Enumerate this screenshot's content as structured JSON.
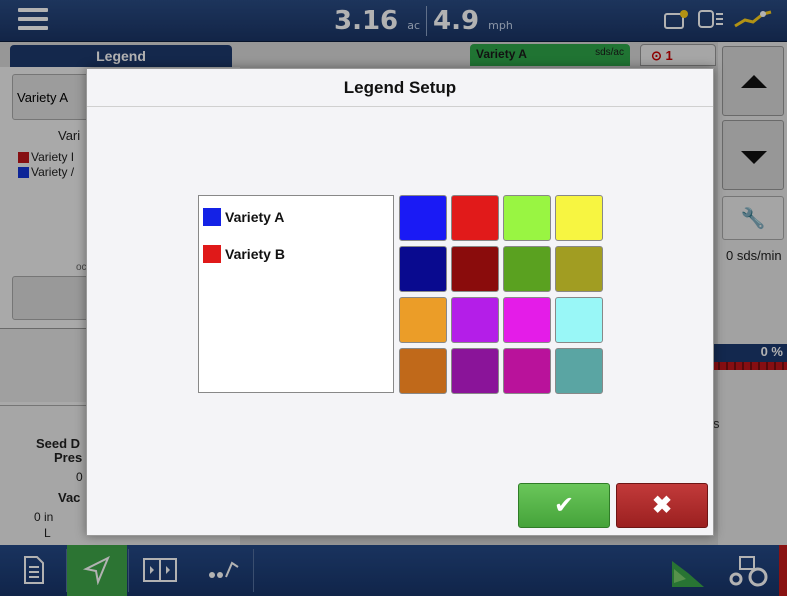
{
  "topbar": {
    "menu_icon": "hamburger-menu-icon",
    "area_value": "3.16",
    "area_unit": "ac",
    "speed_value": "4.9",
    "speed_unit": "mph",
    "status_icons": [
      "gps-icon",
      "display-icon",
      "antenna-icon"
    ]
  },
  "left_panel": {
    "tab_label": "Legend",
    "select_value": "Variety A",
    "column_label": "Vari",
    "legend_items": [
      {
        "label": "Variety I",
        "color": "#c0161b"
      },
      {
        "label": "Variety /",
        "color": "#1436d9"
      }
    ],
    "small_label": "oc"
  },
  "map_header": {
    "variety_tab_label": "Variety A",
    "variety_tab_unit": "sds/ac",
    "alarm_count": "1"
  },
  "right_panel": {
    "rate_text": "0 sds/min",
    "percent_text": "0 %",
    "s_text": "s"
  },
  "bottom_left": {
    "line1": "Seed D",
    "line2": "Pres",
    "line3": "0",
    "line4": "Vac",
    "line5": "0 in",
    "line6": "L"
  },
  "modal": {
    "title": "Legend Setup",
    "items": [
      {
        "label": "Variety A",
        "color": "#1422e6"
      },
      {
        "label": "Variety B",
        "color": "#e01919"
      }
    ],
    "palette": [
      "#1a1af5",
      "#e11a1a",
      "#99f542",
      "#f7f541",
      "#090a8f",
      "#8a0c0c",
      "#5aa120",
      "#a19d22",
      "#eb9d28",
      "#b41ee8",
      "#e41ce8",
      "#99f7f7",
      "#c0691a",
      "#8a1499",
      "#b9129b",
      "#5aa5a3"
    ],
    "ok_label": "✔",
    "cancel_label": "✖"
  },
  "bottombar": {
    "items": [
      "document-icon",
      "navigate-icon",
      "layout-icon",
      "planting-icon"
    ],
    "right_items": [
      "field-icon",
      "tractor-icon"
    ]
  }
}
